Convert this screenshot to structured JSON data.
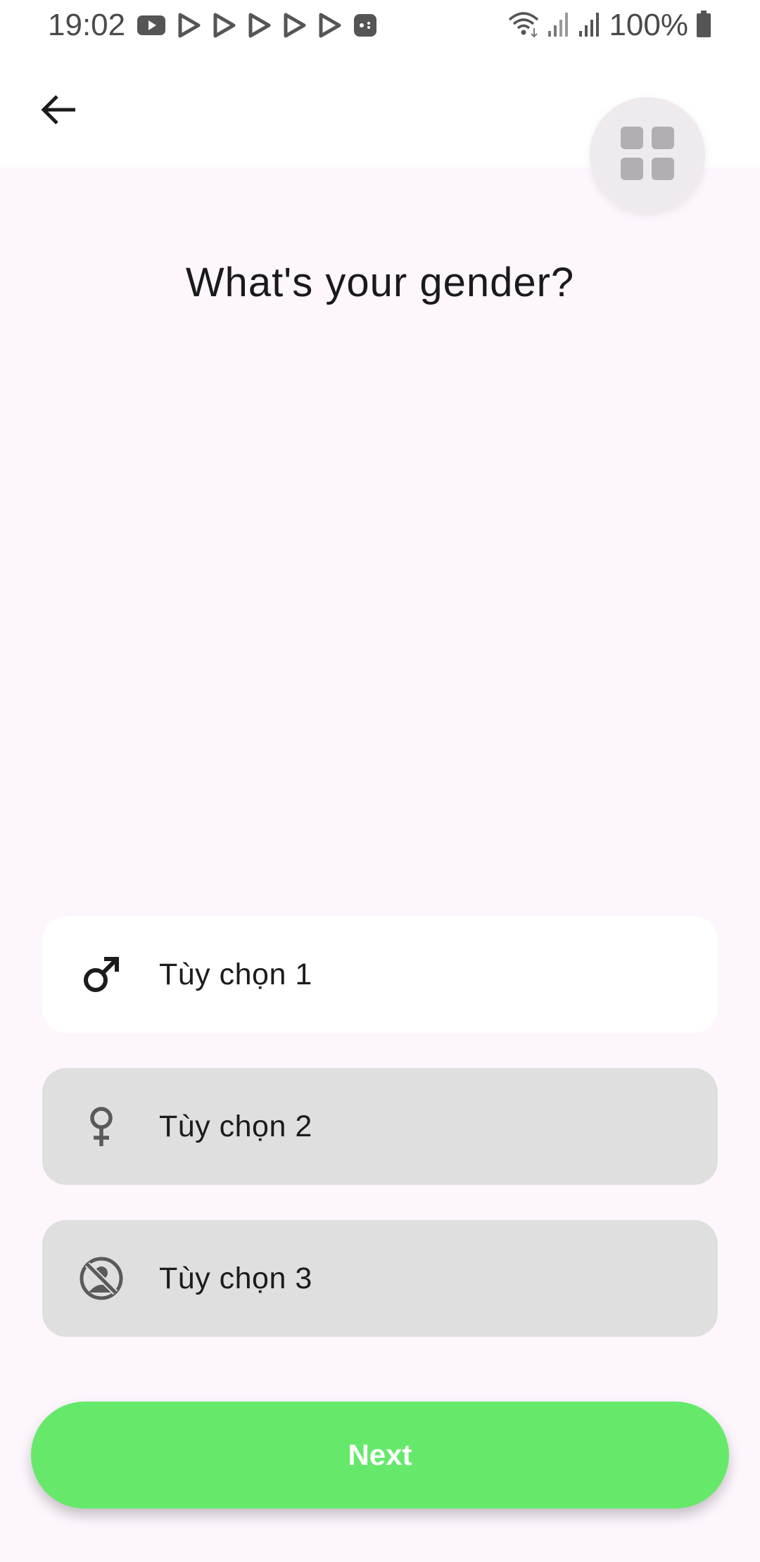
{
  "status_bar": {
    "time": "19:02",
    "battery": "100%",
    "notification_icons": [
      "youtube-icon",
      "play-store-icon",
      "play-store-icon",
      "play-store-icon",
      "play-store-icon",
      "play-store-icon",
      "game-controller-icon"
    ],
    "system_icons": [
      "wifi-icon",
      "signal-icon",
      "signal-icon",
      "battery-icon"
    ]
  },
  "app_bar": {
    "back_icon": "arrow-back-icon",
    "overlay_icon": "grid-icon"
  },
  "page": {
    "title": "What's your gender?"
  },
  "options": [
    {
      "label": "Tùy chọn 1",
      "icon": "male-icon",
      "selected": true
    },
    {
      "label": "Tùy chọn 2",
      "icon": "female-icon",
      "selected": false
    },
    {
      "label": "Tùy chọn 3",
      "icon": "prefer-not-to-say-icon",
      "selected": false
    }
  ],
  "next_button": {
    "label": "Next"
  },
  "colors": {
    "background": "#fdf6fd",
    "selected_option": "#ffffff",
    "unselected_option": "#dfdfdf",
    "accent_green": "#66e96b",
    "text": "#1c1c1c"
  }
}
